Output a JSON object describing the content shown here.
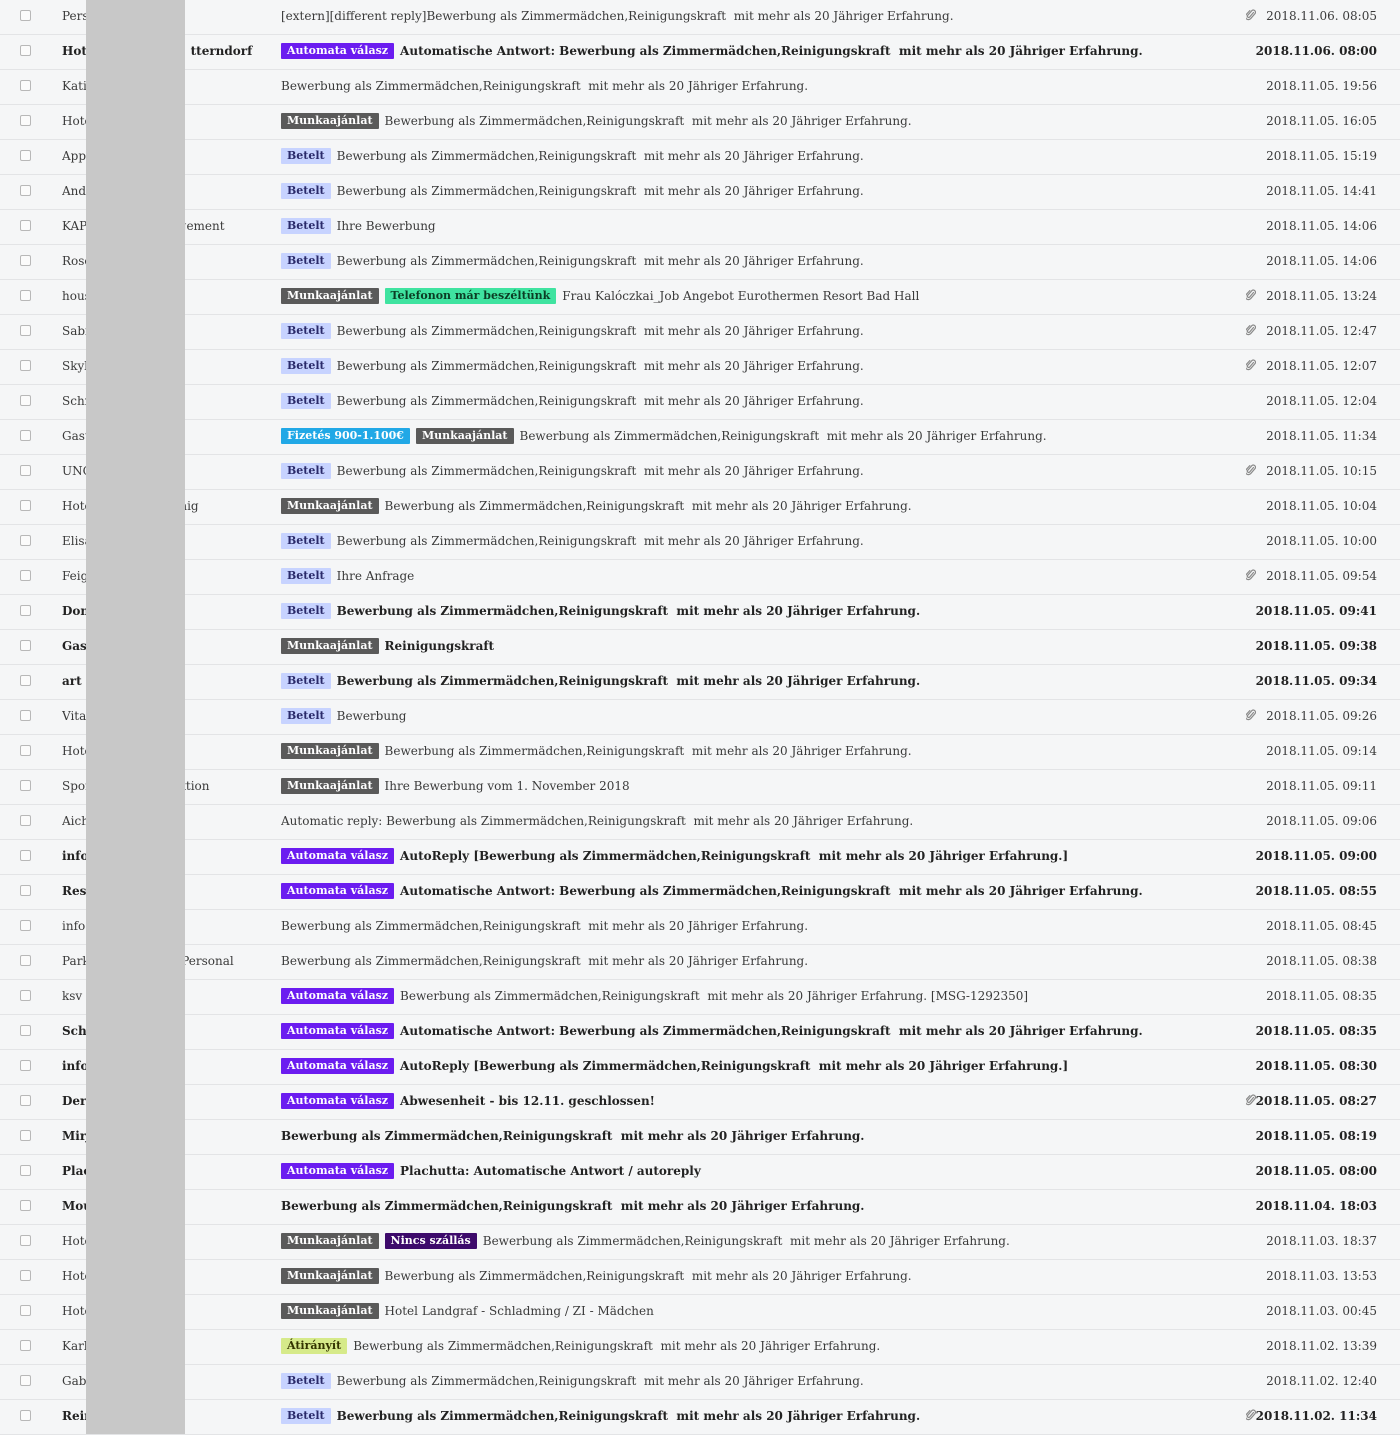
{
  "tag_styles": {
    "Automata válasz": {
      "bg": "#6b1cf0",
      "fg": "#ffffff"
    },
    "Munkaajánlat": {
      "bg": "#5a5a5a",
      "fg": "#ffffff"
    },
    "Betelt": {
      "bg": "#c7d3ff",
      "fg": "#2a2a6a"
    },
    "Telefonon már beszéltünk": {
      "bg": "#3fe3a0",
      "fg": "#0b3d24"
    },
    "Fizetés 900-1.100€": {
      "bg": "#21a8e6",
      "fg": "#ffffff"
    },
    "Nincs szállás": {
      "bg": "#3d0a6b",
      "fg": "#ffffff"
    },
    "Átirányít": {
      "bg": "#d6ea8a",
      "fg": "#333300"
    }
  },
  "emails": [
    {
      "sender": "Pers",
      "tags": [],
      "subject": "[extern][different reply]Bewerbung als Zimmermädchen,Reinigungskraft  mit mehr als 20 Jähriger Erfahrung.",
      "attachment": true,
      "date": "2018.11.06. 08:05",
      "unread": false
    },
    {
      "sender": "Hote                       tterndorf",
      "tags": [
        "Automata válasz"
      ],
      "subject": "Automatische Antwort: Bewerbung als Zimmermädchen,Reinigungskraft  mit mehr als 20 Jähriger Erfahrung.",
      "attachment": false,
      "date": "2018.11.06. 08:00",
      "unread": true
    },
    {
      "sender": "Kati",
      "tags": [],
      "subject": "Bewerbung als Zimmermädchen,Reinigungskraft  mit mehr als 20 Jähriger Erfahrung.",
      "attachment": false,
      "date": "2018.11.05. 19:56",
      "unread": false
    },
    {
      "sender": "Hote",
      "tags": [
        "Munkaajánlat"
      ],
      "subject": "Bewerbung als Zimmermädchen,Reinigungskraft  mit mehr als 20 Jähriger Erfahrung.",
      "attachment": false,
      "date": "2018.11.05. 16:05",
      "unread": false
    },
    {
      "sender": "Appa",
      "tags": [
        "Betelt"
      ],
      "subject": "Bewerbung als Zimmermädchen,Reinigungskraft  mit mehr als 20 Jähriger Erfahrung.",
      "attachment": false,
      "date": "2018.11.05. 15:19",
      "unread": false
    },
    {
      "sender": "Andr",
      "tags": [
        "Betelt"
      ],
      "subject": "Bewerbung als Zimmermädchen,Reinigungskraft  mit mehr als 20 Jähriger Erfahrung.",
      "attachment": false,
      "date": "2018.11.05. 14:41",
      "unread": false
    },
    {
      "sender": "KAP                        gement",
      "tags": [
        "Betelt"
      ],
      "subject": "Ihre Bewerbung",
      "attachment": false,
      "date": "2018.11.05. 14:06",
      "unread": false
    },
    {
      "sender": "Rose",
      "tags": [
        "Betelt"
      ],
      "subject": "Bewerbung als Zimmermädchen,Reinigungskraft  mit mehr als 20 Jähriger Erfahrung.",
      "attachment": false,
      "date": "2018.11.05. 14:06",
      "unread": false
    },
    {
      "sender": "hous",
      "tags": [
        "Munkaajánlat",
        "Telefonon már beszéltünk"
      ],
      "subject": "Frau Kalóczkai_Job Angebot Eurothermen Resort Bad Hall",
      "attachment": true,
      "date": "2018.11.05. 13:24",
      "unread": false
    },
    {
      "sender": "Sabi",
      "tags": [
        "Betelt"
      ],
      "subject": "Bewerbung als Zimmermädchen,Reinigungskraft  mit mehr als 20 Jähriger Erfahrung.",
      "attachment": true,
      "date": "2018.11.05. 12:47",
      "unread": false
    },
    {
      "sender": "Skyb",
      "tags": [
        "Betelt"
      ],
      "subject": "Bewerbung als Zimmermädchen,Reinigungskraft  mit mehr als 20 Jähriger Erfahrung.",
      "attachment": true,
      "date": "2018.11.05. 12:07",
      "unread": false
    },
    {
      "sender": "Schn",
      "tags": [
        "Betelt"
      ],
      "subject": "Bewerbung als Zimmermädchen,Reinigungskraft  mit mehr als 20 Jähriger Erfahrung.",
      "attachment": false,
      "date": "2018.11.05. 12:04",
      "unread": false
    },
    {
      "sender": "Gast",
      "tags": [
        "Fizetés 900-1.100€",
        "Munkaajánlat"
      ],
      "subject": "Bewerbung als Zimmermädchen,Reinigungskraft  mit mehr als 20 Jähriger Erfahrung.",
      "attachment": false,
      "date": "2018.11.05. 11:34",
      "unread": false
    },
    {
      "sender": "UNC",
      "tags": [
        "Betelt"
      ],
      "subject": "Bewerbung als Zimmermädchen,Reinigungskraft  mit mehr als 20 Jähriger Erfahrung.",
      "attachment": true,
      "date": "2018.11.05. 10:15",
      "unread": false
    },
    {
      "sender": "Hote                       nig",
      "tags": [
        "Munkaajánlat"
      ],
      "subject": "Bewerbung als Zimmermädchen,Reinigungskraft  mit mehr als 20 Jähriger Erfahrung.",
      "attachment": false,
      "date": "2018.11.05. 10:04",
      "unread": false
    },
    {
      "sender": "Elisa",
      "tags": [
        "Betelt"
      ],
      "subject": "Bewerbung als Zimmermädchen,Reinigungskraft  mit mehr als 20 Jähriger Erfahrung.",
      "attachment": false,
      "date": "2018.11.05. 10:00",
      "unread": false
    },
    {
      "sender": "Feigl",
      "tags": [
        "Betelt"
      ],
      "subject": "Ihre Anfrage",
      "attachment": true,
      "date": "2018.11.05. 09:54",
      "unread": false
    },
    {
      "sender": "Dona",
      "tags": [
        "Betelt"
      ],
      "subject": "Bewerbung als Zimmermädchen,Reinigungskraft  mit mehr als 20 Jähriger Erfahrung.",
      "attachment": false,
      "date": "2018.11.05. 09:41",
      "unread": true
    },
    {
      "sender": "Gast",
      "tags": [
        "Munkaajánlat"
      ],
      "subject": "Reinigungskraft",
      "attachment": false,
      "date": "2018.11.05. 09:38",
      "unread": true
    },
    {
      "sender": "art",
      "tags": [
        "Betelt"
      ],
      "subject": "Bewerbung als Zimmermädchen,Reinigungskraft  mit mehr als 20 Jähriger Erfahrung.",
      "attachment": false,
      "date": "2018.11.05. 09:34",
      "unread": true
    },
    {
      "sender": "Vital",
      "tags": [
        "Betelt"
      ],
      "subject": "Bewerbung",
      "attachment": true,
      "date": "2018.11.05. 09:26",
      "unread": false
    },
    {
      "sender": "Hote",
      "tags": [
        "Munkaajánlat"
      ],
      "subject": "Bewerbung als Zimmermädchen,Reinigungskraft  mit mehr als 20 Jähriger Erfahrung.",
      "attachment": false,
      "date": "2018.11.05. 09:14",
      "unread": false
    },
    {
      "sender": "Spor                       ktion",
      "tags": [
        "Munkaajánlat"
      ],
      "subject": "Ihre Bewerbung vom 1. November 2018",
      "attachment": false,
      "date": "2018.11.05. 09:11",
      "unread": false
    },
    {
      "sender": "Aich",
      "tags": [],
      "subject": "Automatic reply: Bewerbung als Zimmermädchen,Reinigungskraft  mit mehr als 20 Jähriger Erfahrung.",
      "attachment": false,
      "date": "2018.11.05. 09:06",
      "unread": false
    },
    {
      "sender": "info",
      "tags": [
        "Automata válasz"
      ],
      "subject": "AutoReply [Bewerbung als Zimmermädchen,Reinigungskraft  mit mehr als 20 Jähriger Erfahrung.]",
      "attachment": false,
      "date": "2018.11.05. 09:00",
      "unread": true
    },
    {
      "sender": "Rest",
      "tags": [
        "Automata válasz"
      ],
      "subject": "Automatische Antwort: Bewerbung als Zimmermädchen,Reinigungskraft  mit mehr als 20 Jähriger Erfahrung.",
      "attachment": false,
      "date": "2018.11.05. 08:55",
      "unread": true
    },
    {
      "sender": "info",
      "tags": [],
      "subject": "Bewerbung als Zimmermädchen,Reinigungskraft  mit mehr als 20 Jähriger Erfahrung.",
      "attachment": false,
      "date": "2018.11.05. 08:45",
      "unread": false
    },
    {
      "sender": "Park                        Personal",
      "tags": [],
      "subject": "Bewerbung als Zimmermädchen,Reinigungskraft  mit mehr als 20 Jähriger Erfahrung.",
      "attachment": false,
      "date": "2018.11.05. 08:38",
      "unread": false
    },
    {
      "sender": "ksv",
      "tags": [
        "Automata válasz"
      ],
      "subject": "Bewerbung als Zimmermädchen,Reinigungskraft  mit mehr als 20 Jähriger Erfahrung. [MSG-1292350]",
      "attachment": false,
      "date": "2018.11.05. 08:35",
      "unread": false
    },
    {
      "sender": "Schi",
      "tags": [
        "Automata válasz"
      ],
      "subject": "Automatische Antwort: Bewerbung als Zimmermädchen,Reinigungskraft  mit mehr als 20 Jähriger Erfahrung.",
      "attachment": false,
      "date": "2018.11.05. 08:35",
      "unread": true
    },
    {
      "sender": "info",
      "tags": [
        "Automata válasz"
      ],
      "subject": "AutoReply [Bewerbung als Zimmermädchen,Reinigungskraft  mit mehr als 20 Jähriger Erfahrung.]",
      "attachment": false,
      "date": "2018.11.05. 08:30",
      "unread": true
    },
    {
      "sender": "DerS",
      "tags": [
        "Automata válasz"
      ],
      "subject": "Abwesenheit - bis 12.11. geschlossen!",
      "attachment": true,
      "date": "2018.11.05. 08:27",
      "unread": true
    },
    {
      "sender": "Mirj",
      "tags": [],
      "subject": "Bewerbung als Zimmermädchen,Reinigungskraft  mit mehr als 20 Jähriger Erfahrung.",
      "attachment": false,
      "date": "2018.11.05. 08:19",
      "unread": true
    },
    {
      "sender": "Plac",
      "tags": [
        "Automata válasz"
      ],
      "subject": "Plachutta: Automatische Antwort / autoreply",
      "attachment": false,
      "date": "2018.11.05. 08:00",
      "unread": true
    },
    {
      "sender": "Mou",
      "tags": [],
      "subject": "Bewerbung als Zimmermädchen,Reinigungskraft  mit mehr als 20 Jähriger Erfahrung.",
      "attachment": false,
      "date": "2018.11.04. 18:03",
      "unread": true
    },
    {
      "sender": "Hote",
      "tags": [
        "Munkaajánlat",
        "Nincs szállás"
      ],
      "subject": "Bewerbung als Zimmermädchen,Reinigungskraft  mit mehr als 20 Jähriger Erfahrung.",
      "attachment": false,
      "date": "2018.11.03. 18:37",
      "unread": false
    },
    {
      "sender": "Hote",
      "tags": [
        "Munkaajánlat"
      ],
      "subject": "Bewerbung als Zimmermädchen,Reinigungskraft  mit mehr als 20 Jähriger Erfahrung.",
      "attachment": false,
      "date": "2018.11.03. 13:53",
      "unread": false
    },
    {
      "sender": "Hote",
      "tags": [
        "Munkaajánlat"
      ],
      "subject": "Hotel Landgraf - Schladming / ZI - Mädchen",
      "attachment": false,
      "date": "2018.11.03. 00:45",
      "unread": false
    },
    {
      "sender": "Karli",
      "tags": [
        "Átirányít"
      ],
      "subject": "Bewerbung als Zimmermädchen,Reinigungskraft  mit mehr als 20 Jähriger Erfahrung.",
      "attachment": false,
      "date": "2018.11.02. 13:39",
      "unread": false
    },
    {
      "sender": "Gabr",
      "tags": [
        "Betelt"
      ],
      "subject": "Bewerbung als Zimmermädchen,Reinigungskraft  mit mehr als 20 Jähriger Erfahrung.",
      "attachment": false,
      "date": "2018.11.02. 12:40",
      "unread": false
    },
    {
      "sender": "Rein",
      "tags": [
        "Betelt"
      ],
      "subject": "Bewerbung als Zimmermädchen,Reinigungskraft  mit mehr als 20 Jähriger Erfahrung.",
      "attachment": true,
      "date": "2018.11.02. 11:34",
      "unread": true
    }
  ]
}
